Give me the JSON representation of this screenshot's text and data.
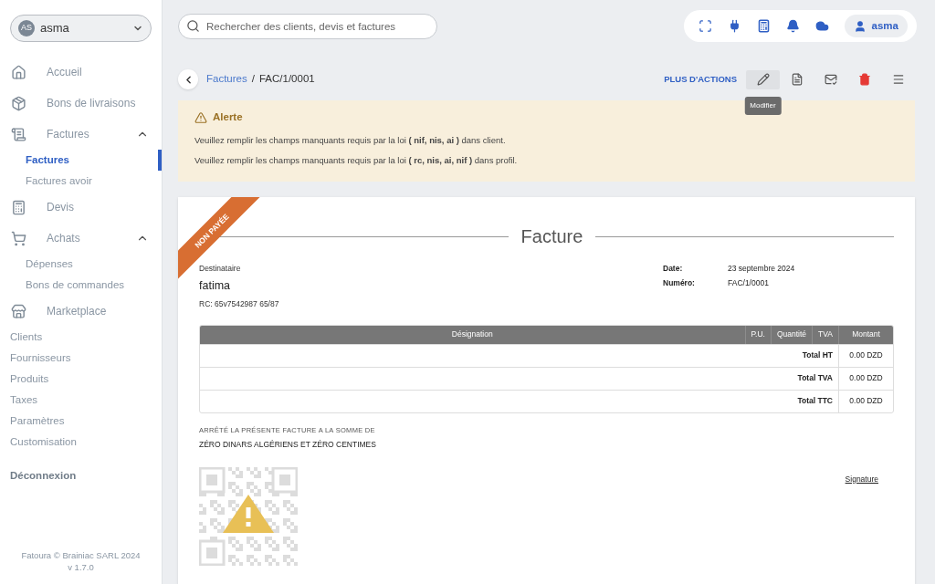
{
  "sidebar": {
    "user": {
      "initials": "AS",
      "name": "asma"
    },
    "nav": [
      {
        "label": "Accueil"
      },
      {
        "label": "Bons de livraisons"
      },
      {
        "label": "Factures",
        "expanded": true,
        "children": [
          {
            "label": "Factures",
            "selected": true
          },
          {
            "label": "Factures avoir",
            "selected": false
          }
        ]
      },
      {
        "label": "Devis"
      },
      {
        "label": "Achats",
        "expanded": true,
        "children": [
          {
            "label": "Dépenses",
            "selected": false
          },
          {
            "label": "Bons de commandes",
            "selected": false
          }
        ]
      },
      {
        "label": "Marketplace"
      }
    ],
    "links": [
      "Clients",
      "Fournisseurs",
      "Produits",
      "Taxes",
      "Paramètres",
      "Customisation"
    ],
    "logout": "Déconnexion",
    "footer": [
      "Fatoura © Brainiac SARL 2024",
      "v 1.7.0"
    ]
  },
  "topbar": {
    "search": {
      "placeholder": "Rechercher des clients, devis et factures"
    },
    "user": "asma"
  },
  "breadcrumb": {
    "items": [
      "Factures",
      "FAC/1/0001"
    ],
    "separator": "/"
  },
  "more_actions": "PLUS D'ACTIONS",
  "actions": [
    {
      "kind": "default",
      "hovered": true,
      "tooltip": "Modifier"
    },
    {
      "kind": "default",
      "hovered": false
    },
    {
      "kind": "default",
      "hovered": false
    },
    {
      "kind": "danger",
      "hovered": false
    },
    {
      "kind": "default",
      "hovered": false
    }
  ],
  "alert": {
    "title": "Alerte",
    "messages": [
      "Veuillez remplir les champs manquants requis par la loi **( nif, nis, ai )** dans client.",
      "Veuillez remplir les champs manquants requis par la loi **( rc, nis, ai, nif )** dans profil."
    ]
  },
  "invoice": {
    "status": "NON PAYÉE",
    "title": "Facture",
    "recipient_label": "Destinataire",
    "recipient": "fatima",
    "rc": "RC: 65v7542987 65/87",
    "meta": [
      {
        "label": "Date:",
        "value": "23 septembre 2024"
      },
      {
        "label": "Numéro:",
        "value": "FAC/1/0001"
      }
    ],
    "columns": [
      "Désignation",
      "P.U.",
      "Quantité",
      "TVA",
      "Montant"
    ],
    "totals": [
      {
        "label": "Total HT",
        "value": "0.00 DZD"
      },
      {
        "label": "Total TVA",
        "value": "0.00 DZD"
      },
      {
        "label": "Total TTC",
        "value": "0.00 DZD"
      }
    ],
    "amount_label": "ARRÊTÉ LA PRÉSENTE FACTURE A LA SOMME DE",
    "amount_words": "ZÉRO DINARS ALGÉRIENS ET ZÉRO CENTIMES",
    "signature": "Signature"
  }
}
